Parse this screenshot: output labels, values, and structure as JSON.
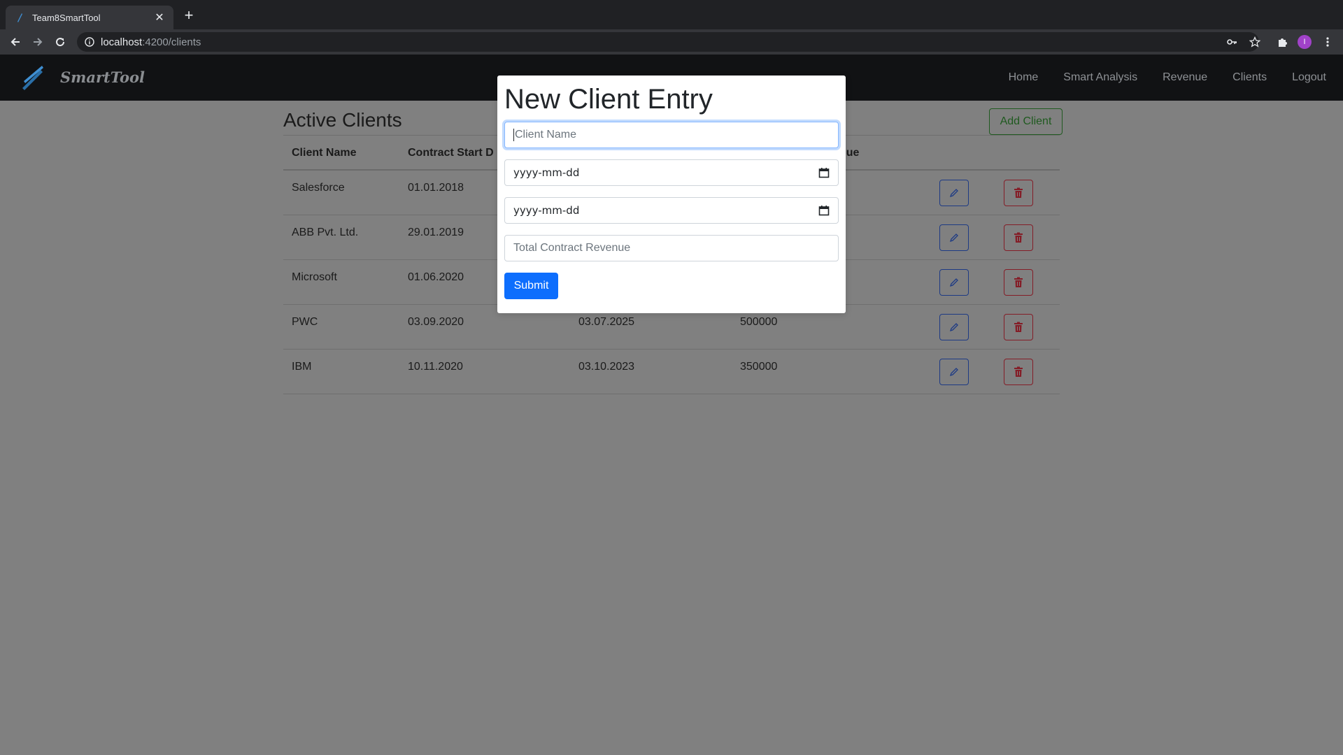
{
  "browser": {
    "tab_title": "Team8SmartTool",
    "url_host": "localhost",
    "url_path": ":4200/clients",
    "avatar_letter": "I"
  },
  "navbar": {
    "brand": "SmartTool",
    "links": [
      "Home",
      "Smart Analysis",
      "Revenue",
      "Clients",
      "Logout"
    ]
  },
  "page": {
    "title": "Active Clients",
    "add_button": "Add Client",
    "columns": [
      "Client Name",
      "Contract Start D",
      "nue"
    ],
    "rows": [
      {
        "name": "Salesforce",
        "start": "01.01.2018",
        "end": "",
        "revenue": ""
      },
      {
        "name": "ABB Pvt. Ltd.",
        "start": "29.01.2019",
        "end": "",
        "revenue": ""
      },
      {
        "name": "Microsoft",
        "start": "01.06.2020",
        "end": "",
        "revenue": ""
      },
      {
        "name": "PWC",
        "start": "03.09.2020",
        "end": "03.07.2025",
        "revenue": "500000"
      },
      {
        "name": "IBM",
        "start": "10.11.2020",
        "end": "03.10.2023",
        "revenue": "350000"
      }
    ]
  },
  "modal": {
    "title": "New Client Entry",
    "client_name_placeholder": "Client Name",
    "start_date_placeholder": "yyyy-mm-dd",
    "end_date_placeholder": "yyyy-mm-dd",
    "revenue_placeholder": "Total Contract Revenue",
    "submit_label": "Submit"
  },
  "colors": {
    "overlay_bg": "#808080",
    "primary": "#0d6efd",
    "edit_border": "#1d3a84",
    "delete_border": "#841d27",
    "add_border": "#1f5a1f"
  }
}
